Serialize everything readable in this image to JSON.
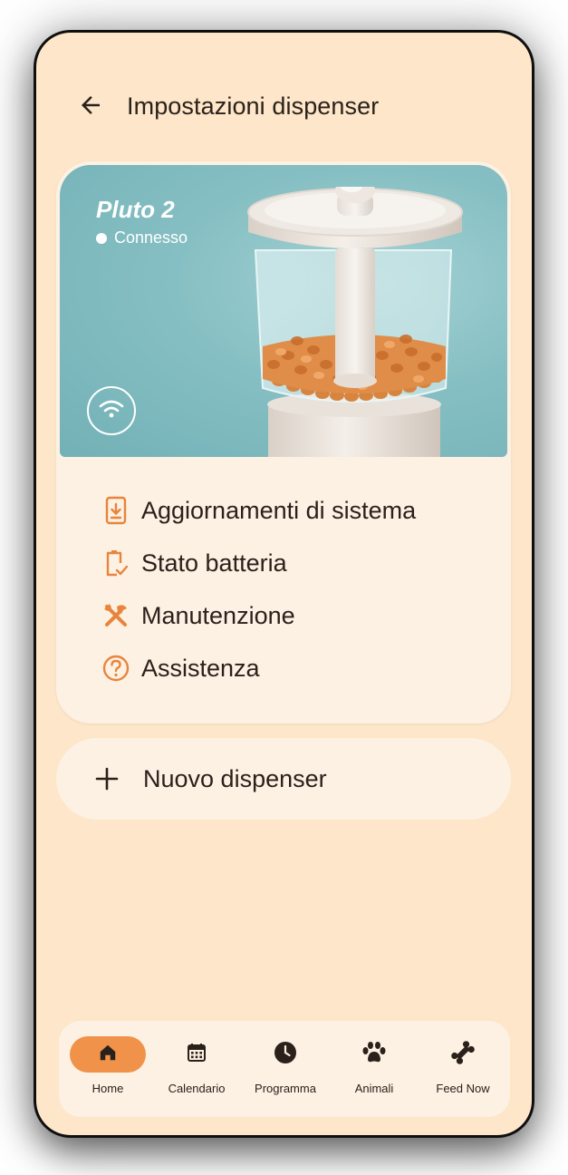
{
  "appbar": {
    "title": "Impostazioni dispenser",
    "back_icon": "arrow-back-icon"
  },
  "device": {
    "name": "Pluto 2",
    "status": "Connesso",
    "connection_icon": "wifi-icon"
  },
  "menu": {
    "items": [
      {
        "label": "Aggiornamenti di sistema",
        "icon": "system-update-icon"
      },
      {
        "label": "Stato batteria",
        "icon": "battery-check-icon"
      },
      {
        "label": "Manutenzione",
        "icon": "tools-icon"
      },
      {
        "label": "Assistenza",
        "icon": "help-circle-icon"
      }
    ]
  },
  "new_dispenser": {
    "label": "Nuovo dispenser",
    "icon": "plus-icon"
  },
  "nav": {
    "items": [
      {
        "label": "Home",
        "icon": "home-icon",
        "active": true
      },
      {
        "label": "Calendario",
        "icon": "calendar-icon",
        "active": false
      },
      {
        "label": "Programma",
        "icon": "clock-icon",
        "active": false
      },
      {
        "label": "Animali",
        "icon": "paw-icon",
        "active": false
      },
      {
        "label": "Feed Now",
        "icon": "bone-icon",
        "active": false
      }
    ]
  },
  "colors": {
    "background": "#fde6c9",
    "card": "#fdf1e3",
    "accent": "#f0924a",
    "text": "#2b211b",
    "hero": "#86bfc3"
  }
}
